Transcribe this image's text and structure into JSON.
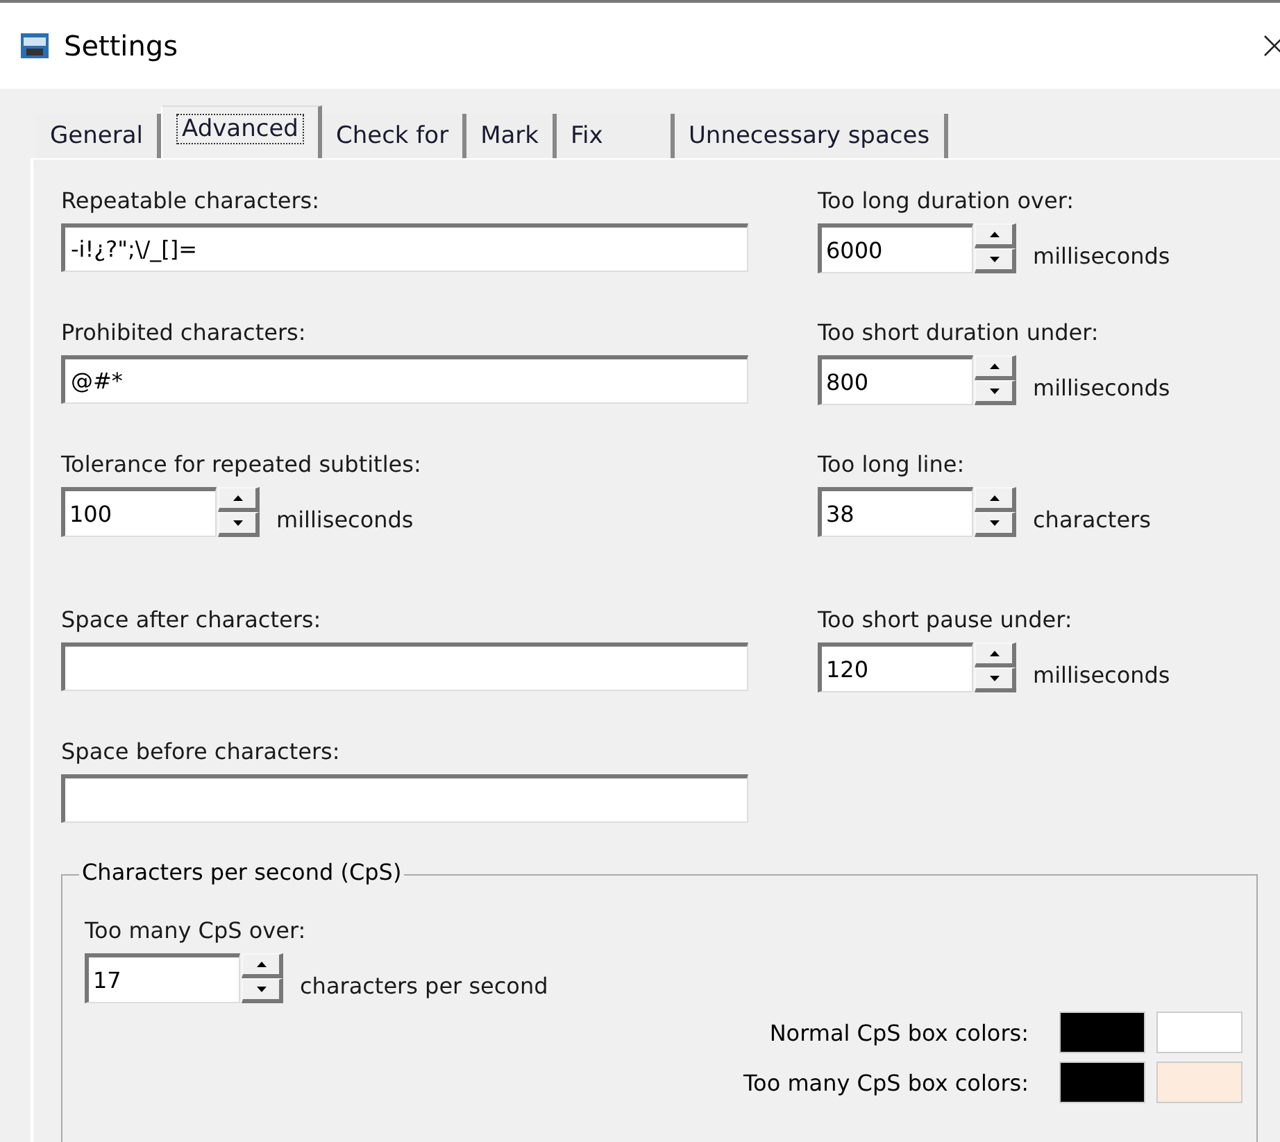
{
  "window": {
    "title": "Settings"
  },
  "tabs": [
    {
      "label": "General",
      "selected": false
    },
    {
      "label": "Advanced",
      "selected": true
    },
    {
      "label": "Check for",
      "selected": false
    },
    {
      "label": "Mark",
      "selected": false
    },
    {
      "label": "Fix",
      "selected": false
    },
    {
      "label": "Unnecessary spaces",
      "selected": false
    }
  ],
  "left_fields": [
    {
      "kind": "text",
      "label": "Repeatable characters:",
      "value": "-i!¿?\";\\/_[]="
    },
    {
      "kind": "text",
      "label": "Prohibited characters:",
      "value": "@#*"
    },
    {
      "kind": "spinner",
      "label": "Tolerance for repeated subtitles:",
      "value": "100",
      "unit": "milliseconds"
    },
    {
      "kind": "text",
      "label": "Space after characters:"
    },
    {
      "kind": "text",
      "label": "Space before characters:"
    }
  ],
  "right_fields": [
    {
      "kind": "spinner",
      "label": "Too long duration over:",
      "value": "6000",
      "unit": "milliseconds"
    },
    {
      "kind": "spinner",
      "label": "Too short duration under:",
      "value": "800",
      "unit": "milliseconds"
    },
    {
      "kind": "spinner",
      "label": "Too long line:",
      "value": "38",
      "unit": "characters"
    },
    {
      "kind": "spinner",
      "label": "Too short pause under:",
      "value": "120",
      "unit": "milliseconds"
    }
  ],
  "cps_group": {
    "title": "Characters per second (CpS)",
    "label": "Too many CpS over:",
    "value": "17",
    "unit": "characters per second",
    "color_rows": [
      {
        "label": "Normal CpS box colors:",
        "colors": [
          {
            "color": "#000000"
          },
          {
            "color": "#ffffff"
          }
        ]
      },
      {
        "label": "Too many CpS box colors:",
        "colors": [
          {
            "color": "#000000"
          },
          {
            "color": "#fdebdd"
          }
        ]
      }
    ]
  }
}
